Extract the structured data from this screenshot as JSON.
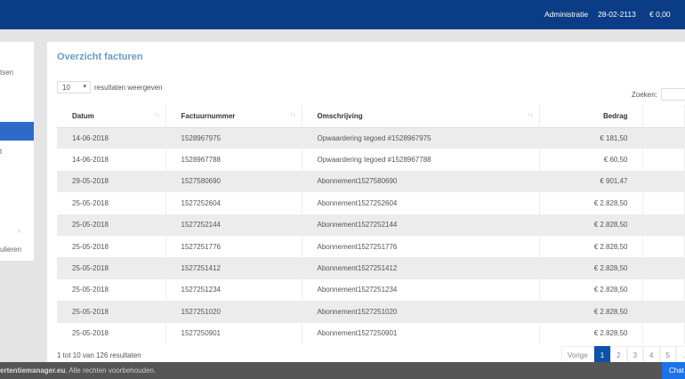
{
  "header": {
    "admin": "Administratie",
    "date": "28-02-2113",
    "balance": "€ 0,00"
  },
  "sidebar": {
    "items": [
      "tsen",
      "t",
      "ulieren"
    ]
  },
  "main": {
    "title": "Overzicht facturen",
    "length_value": "10",
    "length_label": "resultaten weergeven",
    "search_label": "Zoeken:",
    "columns": [
      "Datum",
      "Factuurnummer",
      "Omschrijving",
      "Bedrag"
    ],
    "rows": [
      [
        "14-06-2018",
        "1528967975",
        "Opwaardering tegoed #1528967975",
        "€ 181,50"
      ],
      [
        "14-06-2018",
        "1528967788",
        "Opwaardering tegoed #1528967788",
        "€ 60,50"
      ],
      [
        "29-05-2018",
        "1527580690",
        "Abonnement1527580690",
        "€ 901,47"
      ],
      [
        "25-05-2018",
        "1527252604",
        "Abonnement1527252604",
        "€ 2.828,50"
      ],
      [
        "25-05-2018",
        "1527252144",
        "Abonnement1527252144",
        "€ 2.828,50"
      ],
      [
        "25-05-2018",
        "1527251776",
        "Abonnement1527251776",
        "€ 2.828,50"
      ],
      [
        "25-05-2018",
        "1527251412",
        "Abonnement1527251412",
        "€ 2.828,50"
      ],
      [
        "25-05-2018",
        "1527251234",
        "Abonnement1527251234",
        "€ 2.828,50"
      ],
      [
        "25-05-2018",
        "1527251020",
        "Abonnement1527251020",
        "€ 2.828,50"
      ],
      [
        "25-05-2018",
        "1527250901",
        "Abonnement1527250901",
        "€ 2.828,50"
      ]
    ],
    "info": "1 tot 10 van 126 resultaten",
    "pagination": [
      "Vorige",
      "1",
      "2",
      "3",
      "4",
      "5",
      "..."
    ]
  },
  "footer": {
    "site": "ertentiemanager.eu",
    "text": ", Alle rechten voorbehouden.",
    "chat": "Chat"
  }
}
